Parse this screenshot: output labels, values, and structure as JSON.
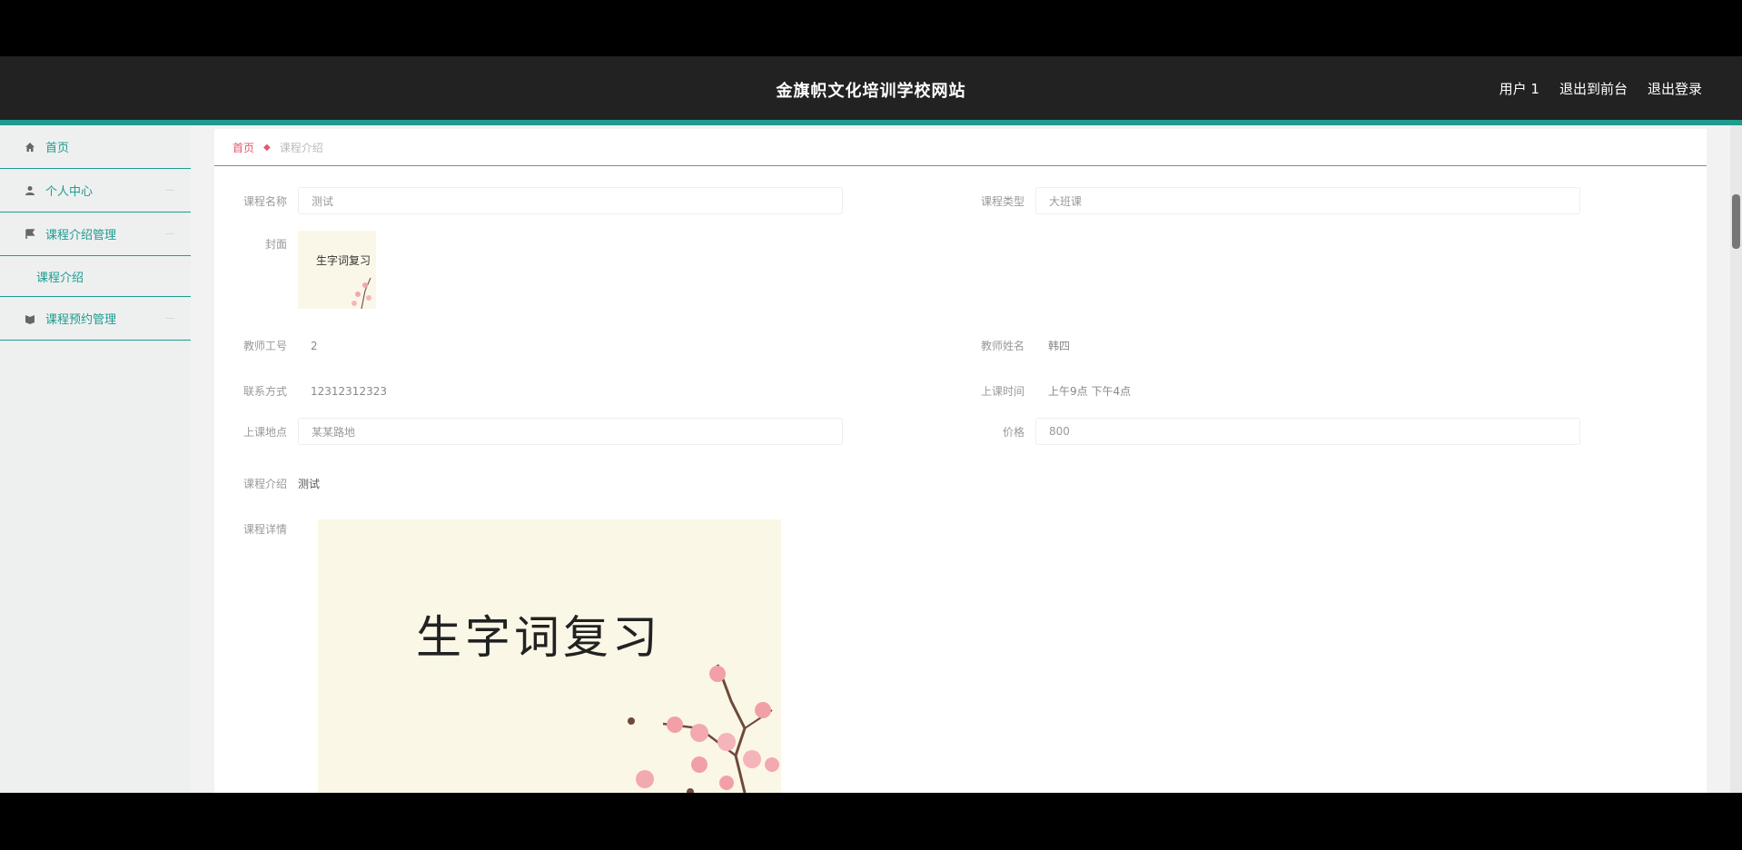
{
  "header": {
    "title": "金旗帜文化培训学校网站",
    "user": "用户 1",
    "to_front": "退出到前台",
    "logout": "退出登录"
  },
  "sidebar": {
    "items": [
      {
        "label": "首页",
        "icon": "home-icon"
      },
      {
        "label": "个人中心",
        "icon": "user-icon"
      },
      {
        "label": "课程介绍管理",
        "icon": "flag-icon"
      },
      {
        "label": "课程介绍",
        "icon": ""
      },
      {
        "label": "课程预约管理",
        "icon": "book-icon"
      }
    ]
  },
  "breadcrumb": {
    "home": "首页",
    "current": "课程介绍"
  },
  "form": {
    "course_name_label": "课程名称",
    "course_name": "测试",
    "course_type_label": "课程类型",
    "course_type": "大班课",
    "cover_label": "封面",
    "cover_text": "生字词复习",
    "teacher_no_label": "教师工号",
    "teacher_no": "2",
    "teacher_name_label": "教师姓名",
    "teacher_name": "韩四",
    "contact_label": "联系方式",
    "contact": "12312312323",
    "class_time_label": "上课时间",
    "class_time": "上午9点 下午4点",
    "location_label": "上课地点",
    "location": "某某路地",
    "price_label": "价格",
    "price": "800",
    "intro_label": "课程介绍",
    "intro": "测试",
    "detail_label": "课程详情",
    "detail_image_text": "生字词复习"
  },
  "colors": {
    "accent": "#1f9b8f",
    "header_bg": "#222222",
    "breadcrumb_red": "#e05a6b"
  }
}
